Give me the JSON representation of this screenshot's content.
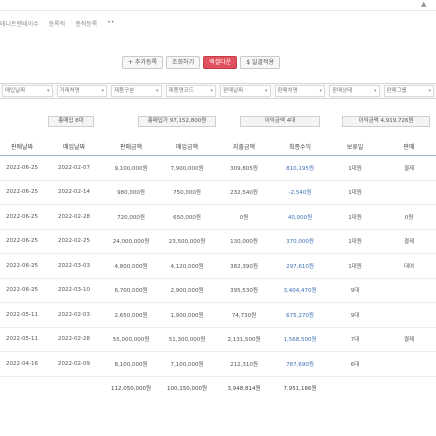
{
  "breadcrumb": [
    "테니트렌테이수",
    "동록적",
    "종적등록",
    "••"
  ],
  "toolbar": {
    "buttons": [
      {
        "label": "+ 추가등록",
        "active": false
      },
      {
        "label": "조회하기",
        "active": false
      },
      {
        "label": "엑셀다운",
        "active": true
      },
      {
        "label": "$ 일괄적용",
        "active": false
      }
    ]
  },
  "filters": [
    "매입날짜",
    "거래처명",
    "제품구분",
    "제품명코드",
    "판매날짜",
    "판매처명",
    "판매상태",
    "판매그룹"
  ],
  "summary": [
    "총매입 8대",
    "총매입가 97,152,800원",
    "이익금액 4대",
    "이익금액 4,919,726원"
  ],
  "table": {
    "columns": [
      "판매날짜",
      "매입날짜",
      "판매금액",
      "매입금액",
      "지출금액",
      "최종수익",
      "보류일",
      "판매"
    ],
    "rows": [
      [
        "2022-06-25",
        "2022-02-07",
        "9,100,000원",
        "7,900,000원",
        "309,805원",
        "810,195원",
        "1대원",
        "결제"
      ],
      [
        "2022-06-25",
        "2022-02-14",
        "980,000원",
        "750,000원",
        "232,540원",
        "-2,540원",
        "1대원",
        ""
      ],
      [
        "2022-06-25",
        "2022-02-28",
        "720,000원",
        "650,000원",
        "0원",
        "40,000원",
        "1대원",
        "0원"
      ],
      [
        "2022-06-25",
        "2022-02-25",
        "24,000,000원",
        "23,500,000원",
        "130,000원",
        "370,000원",
        "1대원",
        "결제"
      ],
      [
        "2022-06-25",
        "2022-03-03",
        "4,800,000원",
        "4,120,000원",
        "382,390원",
        "297,610원",
        "1대원",
        "대여"
      ],
      [
        "2022-06-25",
        "2022-03-10",
        "6,700,000원",
        "2,900,000원",
        "395,530원",
        "3,404,470원",
        "9대",
        ""
      ],
      [
        "2022-05-11",
        "2022-02-03",
        "2,650,000원",
        "1,900,000원",
        "74,730원",
        "675,270원",
        "9대",
        ""
      ],
      [
        "2022-05-11",
        "2022-02-28",
        "55,000,000원",
        "51,300,000원",
        "2,131,500원",
        "1,568,500원",
        "7대",
        "결제"
      ],
      [
        "2022-04-16",
        "2022-02-09",
        "8,100,000원",
        "7,100,000원",
        "212,310원",
        "787,690원",
        "6대",
        ""
      ]
    ],
    "totals": [
      "",
      "",
      "112,050,000원",
      "100,150,000원",
      "3,948,814원",
      "7,951,186원",
      "",
      ""
    ]
  },
  "colors": {
    "accent_button": "#e0505c",
    "header_rule": "#9db6d6"
  }
}
